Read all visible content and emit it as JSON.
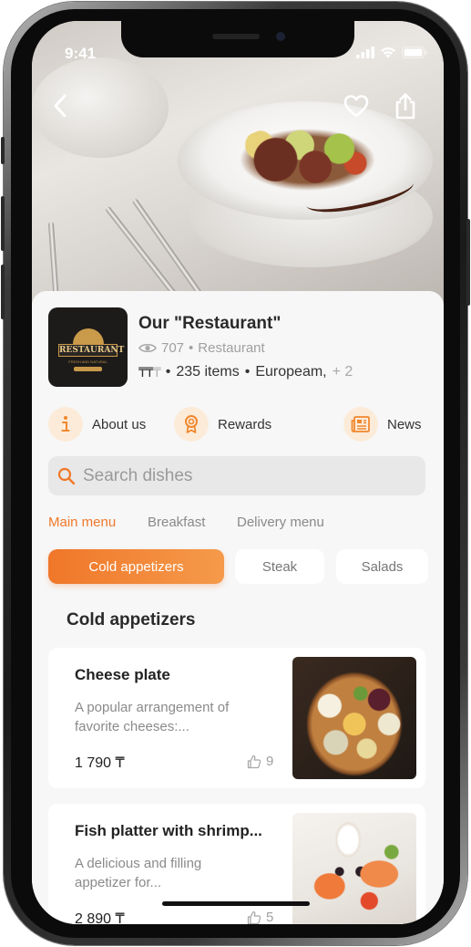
{
  "status": {
    "time": "9:41"
  },
  "restaurant": {
    "name": "Our \"Restaurant\"",
    "views": "707",
    "category": "Restaurant",
    "price_level_active": "₸₸",
    "price_level_inactive": "₸",
    "items": "235 items",
    "cuisine": "Europeam,",
    "cuisine_more": "+ 2",
    "logo_text": "RESTAURANT",
    "logo_sub": "FRESH AND NATURAL"
  },
  "quick_links": [
    {
      "label": "About us",
      "icon": "info-icon"
    },
    {
      "label": "Rewards",
      "icon": "award-icon"
    },
    {
      "label": "News",
      "icon": "newspaper-icon"
    }
  ],
  "search": {
    "placeholder": "Search dishes"
  },
  "menu_tabs": [
    {
      "label": "Main menu",
      "active": true
    },
    {
      "label": "Breakfast",
      "active": false
    },
    {
      "label": "Delivery menu",
      "active": false
    }
  ],
  "category_chips": [
    {
      "label": "Cold appetizers",
      "active": true
    },
    {
      "label": "Steak",
      "active": false
    },
    {
      "label": "Salads",
      "active": false
    }
  ],
  "section_title": "Cold appetizers",
  "dishes": [
    {
      "title": "Cheese plate",
      "description": "A popular arrangement of favorite cheeses:...",
      "price": "1 790 ₸",
      "likes": "9",
      "image_icon": "cheese-plate-image"
    },
    {
      "title": "Fish platter with shrimp...",
      "description": "A delicious and filling appetizer for...",
      "price": "2 890 ₸",
      "likes": "5",
      "image_icon": "fish-platter-image"
    }
  ],
  "colors": {
    "accent": "#f0782a",
    "chip_gradient_end": "#f59a4a",
    "icon_bg": "#fcebd9",
    "sheet_bg": "#f7f7f7"
  }
}
